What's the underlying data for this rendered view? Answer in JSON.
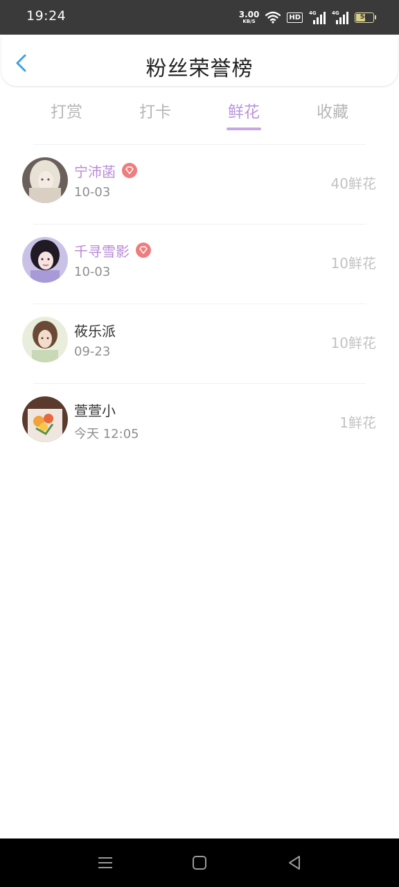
{
  "status_bar": {
    "time": "19:24",
    "net_speed_value": "3.00",
    "net_speed_unit": "KB/S",
    "hd_label": "HD",
    "signal_1_label": "4G",
    "signal_2_label": "4G",
    "battery_level": "50",
    "icons": [
      "wifi-icon",
      "signal-icon",
      "battery-icon"
    ]
  },
  "header": {
    "title": "粉丝荣誉榜",
    "back_icon": "chevron-left-icon"
  },
  "tabs": [
    {
      "label": "打赏",
      "active": false
    },
    {
      "label": "打卡",
      "active": false
    },
    {
      "label": "鲜花",
      "active": true
    },
    {
      "label": "收藏",
      "active": false
    }
  ],
  "fans": [
    {
      "name": "宁沛菡",
      "vip": true,
      "date": "10-03",
      "amount": "40鲜花"
    },
    {
      "name": "千寻雪影",
      "vip": true,
      "date": "10-03",
      "amount": "10鲜花"
    },
    {
      "name": "莜乐派",
      "vip": false,
      "date": "09-23",
      "amount": "10鲜花"
    },
    {
      "name": "萱萱小",
      "vip": false,
      "date": "今天 12:05",
      "amount": "1鲜花"
    }
  ],
  "nav": {
    "icons": [
      "menu-icon",
      "home-icon",
      "back-icon"
    ]
  },
  "colors": {
    "accent": "#b995dd",
    "vip_name": "#b88ad9",
    "vip_badge": "#f07c7c",
    "back_arrow": "#3aa3e0"
  }
}
